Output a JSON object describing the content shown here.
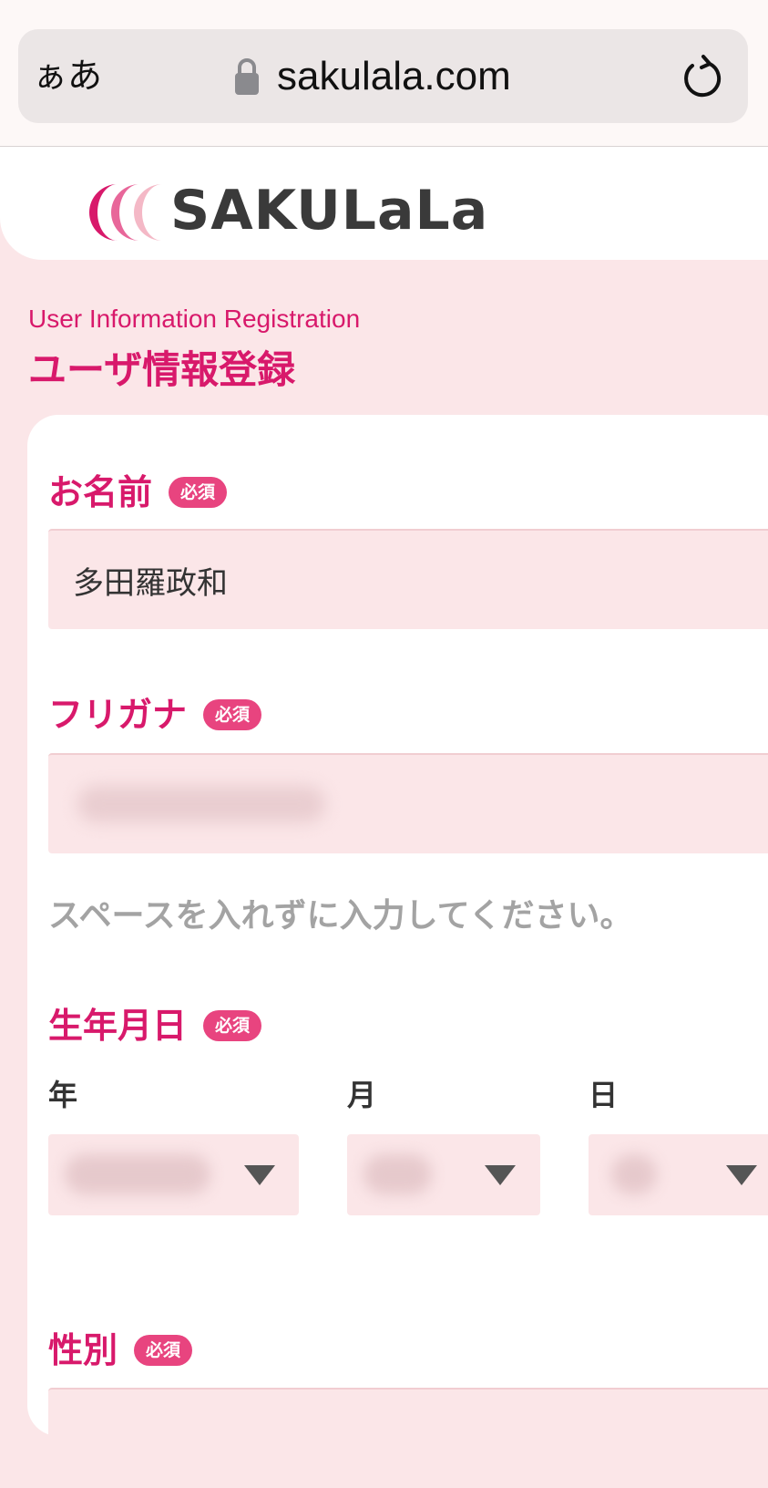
{
  "browser": {
    "text_size_label": "ぁあ",
    "url": "sakulala.com"
  },
  "site": {
    "logo_text": "SAKULaLa",
    "brand_colors": {
      "accent": "#d8196b",
      "badge": "#e8447f",
      "field_bg": "#fbe6e8"
    }
  },
  "page": {
    "subtitle_en": "User Information Registration",
    "title": "ユーザ情報登録"
  },
  "form": {
    "required_badge": "必須",
    "name": {
      "label": "お名前",
      "value": "多田羅政和"
    },
    "furigana": {
      "label": "フリガナ",
      "helper": "スペースを入れずに入力してください。"
    },
    "birthdate": {
      "label": "生年月日",
      "year_label": "年",
      "month_label": "月",
      "day_label": "日"
    },
    "gender": {
      "label": "性別"
    }
  },
  "icons": {
    "lock": "lock-icon",
    "reload": "reload-icon",
    "select": "chevron-down-icon"
  }
}
